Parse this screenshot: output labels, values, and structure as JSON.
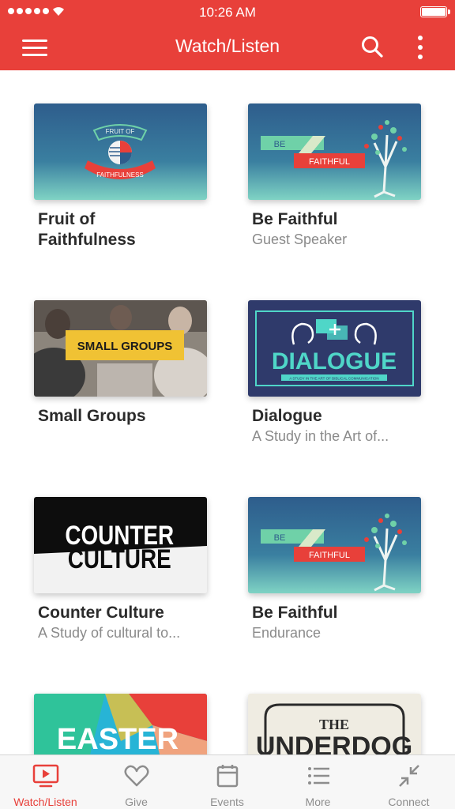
{
  "status": {
    "time": "10:26 AM"
  },
  "header": {
    "title": "Watch/Listen"
  },
  "items": [
    {
      "title": "Fruit of Faithfulness",
      "subtitle": "",
      "art": {
        "top": "FRUIT OF",
        "bottom": "FAITHFULNESS"
      }
    },
    {
      "title": "Be Faithful",
      "subtitle": "Guest Speaker",
      "art": {
        "be": "BE",
        "faithful": "FAITHFUL"
      }
    },
    {
      "title": "Small Groups",
      "subtitle": "",
      "art": {
        "label": "SMALL GROUPS"
      }
    },
    {
      "title": "Dialogue",
      "subtitle": "A Study in the Art of...",
      "art": {
        "word": "DIALOGUE",
        "tag": "A STUDY IN THE ART OF BIBLICAL COMMUNICATION"
      }
    },
    {
      "title": "Counter Culture",
      "subtitle": "A Study of cultural to...",
      "art": {
        "line1": "COUNTER",
        "line2": "CULTURE"
      }
    },
    {
      "title": "Be Faithful",
      "subtitle": "Endurance",
      "art": {
        "be": "BE",
        "faithful": "FAITHFUL"
      }
    },
    {
      "title": "",
      "subtitle": "",
      "art": {
        "word": "EASTER"
      }
    },
    {
      "title": "",
      "subtitle": "",
      "art": {
        "the": "THE",
        "word": "UNDERDOG"
      }
    }
  ],
  "tabs": [
    {
      "label": "Watch/Listen",
      "icon": "play-screen-icon",
      "active": true
    },
    {
      "label": "Give",
      "icon": "heart-icon",
      "active": false
    },
    {
      "label": "Events",
      "icon": "calendar-icon",
      "active": false
    },
    {
      "label": "More",
      "icon": "list-icon",
      "active": false
    },
    {
      "label": "Connect",
      "icon": "collapse-arrows-icon",
      "active": false
    }
  ],
  "colors": {
    "brand": "#e8403a",
    "tab_inactive": "#8d8d8d"
  }
}
